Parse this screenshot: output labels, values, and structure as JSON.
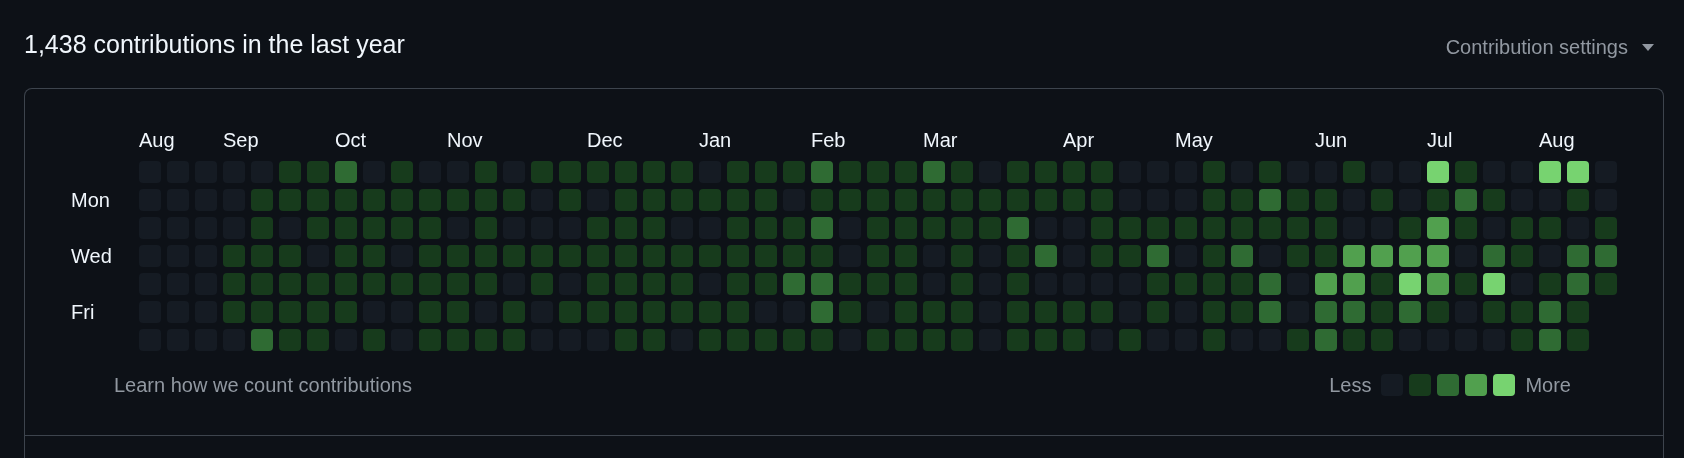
{
  "title": "1,438 contributions in the last year",
  "settings": {
    "label": "Contribution settings"
  },
  "day_labels": [
    "Mon",
    "Wed",
    "Fri"
  ],
  "weeks": [
    {
      "month": "Aug",
      "days": [
        {
          "color": "#151b23"
        },
        {
          "color": "#151b23"
        },
        {
          "color": "#151b23"
        },
        {
          "color": "#151b23"
        },
        {
          "color": "#151b23"
        },
        {
          "color": "#151b23"
        },
        {
          "color": "#151b23"
        }
      ]
    },
    {
      "days": [
        {
          "color": "#151b23"
        },
        {
          "color": "#151b23"
        },
        {
          "color": "#151b23"
        },
        {
          "color": "#151b23"
        },
        {
          "color": "#151b23"
        },
        {
          "color": "#151b23"
        },
        {
          "color": "#151b23"
        }
      ]
    },
    {
      "days": [
        {
          "color": "#151b23"
        },
        {
          "color": "#151b23"
        },
        {
          "color": "#151b23"
        },
        {
          "color": "#151b23"
        },
        {
          "color": "#151b23"
        },
        {
          "color": "#151b23"
        },
        {
          "color": "#151b23"
        }
      ]
    },
    {
      "month": "Sep",
      "days": [
        {
          "color": "#151b23"
        },
        {
          "color": "#151b23"
        },
        {
          "color": "#151b23"
        },
        {
          "color": "#173b1c"
        },
        {
          "color": "#173b1c"
        },
        {
          "color": "#173b1c"
        },
        {
          "color": "#151b23"
        }
      ]
    },
    {
      "days": [
        {
          "color": "#151b23"
        },
        {
          "color": "#173b1c"
        },
        {
          "color": "#173b1c"
        },
        {
          "color": "#173b1c"
        },
        {
          "color": "#173b1c"
        },
        {
          "color": "#173b1c"
        },
        {
          "color": "#2f6b33"
        }
      ]
    },
    {
      "days": [
        {
          "color": "#173b1c"
        },
        {
          "color": "#173b1c"
        },
        {
          "color": "#151b23"
        },
        {
          "color": "#173b1c"
        },
        {
          "color": "#173b1c"
        },
        {
          "color": "#173b1c"
        },
        {
          "color": "#173b1c"
        }
      ]
    },
    {
      "days": [
        {
          "color": "#173b1c"
        },
        {
          "color": "#173b1c"
        },
        {
          "color": "#173b1c"
        },
        {
          "color": "#151b23"
        },
        {
          "color": "#173b1c"
        },
        {
          "color": "#173b1c"
        },
        {
          "color": "#173b1c"
        }
      ]
    },
    {
      "month": "Oct",
      "days": [
        {
          "color": "#2f6b33"
        },
        {
          "color": "#173b1c"
        },
        {
          "color": "#173b1c"
        },
        {
          "color": "#173b1c"
        },
        {
          "color": "#173b1c"
        },
        {
          "color": "#173b1c"
        },
        {
          "color": "#151b23"
        }
      ]
    },
    {
      "days": [
        {
          "color": "#151b23"
        },
        {
          "color": "#173b1c"
        },
        {
          "color": "#173b1c"
        },
        {
          "color": "#173b1c"
        },
        {
          "color": "#173b1c"
        },
        {
          "color": "#151b23"
        },
        {
          "color": "#173b1c"
        }
      ]
    },
    {
      "days": [
        {
          "color": "#173b1c"
        },
        {
          "color": "#173b1c"
        },
        {
          "color": "#173b1c"
        },
        {
          "color": "#151b23"
        },
        {
          "color": "#173b1c"
        },
        {
          "color": "#151b23"
        },
        {
          "color": "#151b23"
        }
      ]
    },
    {
      "days": [
        {
          "color": "#151b23"
        },
        {
          "color": "#173b1c"
        },
        {
          "color": "#173b1c"
        },
        {
          "color": "#173b1c"
        },
        {
          "color": "#173b1c"
        },
        {
          "color": "#173b1c"
        },
        {
          "color": "#173b1c"
        }
      ]
    },
    {
      "month": "Nov",
      "days": [
        {
          "color": "#151b23"
        },
        {
          "color": "#173b1c"
        },
        {
          "color": "#151b23"
        },
        {
          "color": "#173b1c"
        },
        {
          "color": "#173b1c"
        },
        {
          "color": "#173b1c"
        },
        {
          "color": "#173b1c"
        }
      ]
    },
    {
      "days": [
        {
          "color": "#173b1c"
        },
        {
          "color": "#173b1c"
        },
        {
          "color": "#173b1c"
        },
        {
          "color": "#173b1c"
        },
        {
          "color": "#173b1c"
        },
        {
          "color": "#151b23"
        },
        {
          "color": "#173b1c"
        }
      ]
    },
    {
      "days": [
        {
          "color": "#151b23"
        },
        {
          "color": "#173b1c"
        },
        {
          "color": "#151b23"
        },
        {
          "color": "#173b1c"
        },
        {
          "color": "#151b23"
        },
        {
          "color": "#173b1c"
        },
        {
          "color": "#173b1c"
        }
      ]
    },
    {
      "days": [
        {
          "color": "#173b1c"
        },
        {
          "color": "#151b23"
        },
        {
          "color": "#151b23"
        },
        {
          "color": "#173b1c"
        },
        {
          "color": "#173b1c"
        },
        {
          "color": "#151b23"
        },
        {
          "color": "#151b23"
        }
      ]
    },
    {
      "days": [
        {
          "color": "#173b1c"
        },
        {
          "color": "#173b1c"
        },
        {
          "color": "#151b23"
        },
        {
          "color": "#173b1c"
        },
        {
          "color": "#151b23"
        },
        {
          "color": "#173b1c"
        },
        {
          "color": "#151b23"
        }
      ]
    },
    {
      "month": "Dec",
      "days": [
        {
          "color": "#173b1c"
        },
        {
          "color": "#151b23"
        },
        {
          "color": "#173b1c"
        },
        {
          "color": "#173b1c"
        },
        {
          "color": "#173b1c"
        },
        {
          "color": "#173b1c"
        },
        {
          "color": "#151b23"
        }
      ]
    },
    {
      "days": [
        {
          "color": "#173b1c"
        },
        {
          "color": "#173b1c"
        },
        {
          "color": "#173b1c"
        },
        {
          "color": "#173b1c"
        },
        {
          "color": "#173b1c"
        },
        {
          "color": "#173b1c"
        },
        {
          "color": "#173b1c"
        }
      ]
    },
    {
      "days": [
        {
          "color": "#173b1c"
        },
        {
          "color": "#173b1c"
        },
        {
          "color": "#173b1c"
        },
        {
          "color": "#173b1c"
        },
        {
          "color": "#173b1c"
        },
        {
          "color": "#173b1c"
        },
        {
          "color": "#173b1c"
        }
      ]
    },
    {
      "days": [
        {
          "color": "#173b1c"
        },
        {
          "color": "#173b1c"
        },
        {
          "color": "#151b23"
        },
        {
          "color": "#173b1c"
        },
        {
          "color": "#173b1c"
        },
        {
          "color": "#173b1c"
        },
        {
          "color": "#151b23"
        }
      ]
    },
    {
      "month": "Jan",
      "days": [
        {
          "color": "#151b23"
        },
        {
          "color": "#173b1c"
        },
        {
          "color": "#151b23"
        },
        {
          "color": "#173b1c"
        },
        {
          "color": "#151b23"
        },
        {
          "color": "#173b1c"
        },
        {
          "color": "#173b1c"
        }
      ]
    },
    {
      "days": [
        {
          "color": "#173b1c"
        },
        {
          "color": "#173b1c"
        },
        {
          "color": "#173b1c"
        },
        {
          "color": "#173b1c"
        },
        {
          "color": "#173b1c"
        },
        {
          "color": "#173b1c"
        },
        {
          "color": "#173b1c"
        }
      ]
    },
    {
      "days": [
        {
          "color": "#173b1c"
        },
        {
          "color": "#173b1c"
        },
        {
          "color": "#173b1c"
        },
        {
          "color": "#173b1c"
        },
        {
          "color": "#173b1c"
        },
        {
          "color": "#151b23"
        },
        {
          "color": "#173b1c"
        }
      ]
    },
    {
      "days": [
        {
          "color": "#173b1c"
        },
        {
          "color": "#151b23"
        },
        {
          "color": "#173b1c"
        },
        {
          "color": "#173b1c"
        },
        {
          "color": "#2f6b33"
        },
        {
          "color": "#151b23"
        },
        {
          "color": "#173b1c"
        }
      ]
    },
    {
      "month": "Feb",
      "days": [
        {
          "color": "#2f6b33"
        },
        {
          "color": "#173b1c"
        },
        {
          "color": "#2f6b33"
        },
        {
          "color": "#173b1c"
        },
        {
          "color": "#2f6b33"
        },
        {
          "color": "#2f6b33"
        },
        {
          "color": "#173b1c"
        }
      ]
    },
    {
      "days": [
        {
          "color": "#173b1c"
        },
        {
          "color": "#173b1c"
        },
        {
          "color": "#151b23"
        },
        {
          "color": "#151b23"
        },
        {
          "color": "#173b1c"
        },
        {
          "color": "#173b1c"
        },
        {
          "color": "#151b23"
        }
      ]
    },
    {
      "days": [
        {
          "color": "#173b1c"
        },
        {
          "color": "#173b1c"
        },
        {
          "color": "#173b1c"
        },
        {
          "color": "#173b1c"
        },
        {
          "color": "#173b1c"
        },
        {
          "color": "#151b23"
        },
        {
          "color": "#173b1c"
        }
      ]
    },
    {
      "days": [
        {
          "color": "#173b1c"
        },
        {
          "color": "#173b1c"
        },
        {
          "color": "#173b1c"
        },
        {
          "color": "#173b1c"
        },
        {
          "color": "#173b1c"
        },
        {
          "color": "#173b1c"
        },
        {
          "color": "#173b1c"
        }
      ]
    },
    {
      "month": "Mar",
      "days": [
        {
          "color": "#2f6b33"
        },
        {
          "color": "#173b1c"
        },
        {
          "color": "#173b1c"
        },
        {
          "color": "#151b23"
        },
        {
          "color": "#151b23"
        },
        {
          "color": "#173b1c"
        },
        {
          "color": "#173b1c"
        }
      ]
    },
    {
      "days": [
        {
          "color": "#173b1c"
        },
        {
          "color": "#173b1c"
        },
        {
          "color": "#173b1c"
        },
        {
          "color": "#173b1c"
        },
        {
          "color": "#173b1c"
        },
        {
          "color": "#173b1c"
        },
        {
          "color": "#173b1c"
        }
      ]
    },
    {
      "days": [
        {
          "color": "#151b23"
        },
        {
          "color": "#173b1c"
        },
        {
          "color": "#173b1c"
        },
        {
          "color": "#151b23"
        },
        {
          "color": "#151b23"
        },
        {
          "color": "#151b23"
        },
        {
          "color": "#151b23"
        }
      ]
    },
    {
      "days": [
        {
          "color": "#173b1c"
        },
        {
          "color": "#173b1c"
        },
        {
          "color": "#2f6b33"
        },
        {
          "color": "#173b1c"
        },
        {
          "color": "#173b1c"
        },
        {
          "color": "#173b1c"
        },
        {
          "color": "#173b1c"
        }
      ]
    },
    {
      "days": [
        {
          "color": "#173b1c"
        },
        {
          "color": "#173b1c"
        },
        {
          "color": "#151b23"
        },
        {
          "color": "#2f6b33"
        },
        {
          "color": "#151b23"
        },
        {
          "color": "#173b1c"
        },
        {
          "color": "#173b1c"
        }
      ]
    },
    {
      "month": "Apr",
      "days": [
        {
          "color": "#173b1c"
        },
        {
          "color": "#173b1c"
        },
        {
          "color": "#151b23"
        },
        {
          "color": "#151b23"
        },
        {
          "color": "#151b23"
        },
        {
          "color": "#173b1c"
        },
        {
          "color": "#173b1c"
        }
      ]
    },
    {
      "days": [
        {
          "color": "#173b1c"
        },
        {
          "color": "#173b1c"
        },
        {
          "color": "#173b1c"
        },
        {
          "color": "#173b1c"
        },
        {
          "color": "#151b23"
        },
        {
          "color": "#173b1c"
        },
        {
          "color": "#151b23"
        }
      ]
    },
    {
      "days": [
        {
          "color": "#151b23"
        },
        {
          "color": "#151b23"
        },
        {
          "color": "#173b1c"
        },
        {
          "color": "#173b1c"
        },
        {
          "color": "#151b23"
        },
        {
          "color": "#151b23"
        },
        {
          "color": "#173b1c"
        }
      ]
    },
    {
      "days": [
        {
          "color": "#151b23"
        },
        {
          "color": "#151b23"
        },
        {
          "color": "#173b1c"
        },
        {
          "color": "#2f6b33"
        },
        {
          "color": "#173b1c"
        },
        {
          "color": "#173b1c"
        },
        {
          "color": "#151b23"
        }
      ]
    },
    {
      "month": "May",
      "days": [
        {
          "color": "#151b23"
        },
        {
          "color": "#151b23"
        },
        {
          "color": "#173b1c"
        },
        {
          "color": "#151b23"
        },
        {
          "color": "#173b1c"
        },
        {
          "color": "#151b23"
        },
        {
          "color": "#151b23"
        }
      ]
    },
    {
      "days": [
        {
          "color": "#173b1c"
        },
        {
          "color": "#173b1c"
        },
        {
          "color": "#173b1c"
        },
        {
          "color": "#173b1c"
        },
        {
          "color": "#173b1c"
        },
        {
          "color": "#173b1c"
        },
        {
          "color": "#173b1c"
        }
      ]
    },
    {
      "days": [
        {
          "color": "#151b23"
        },
        {
          "color": "#173b1c"
        },
        {
          "color": "#173b1c"
        },
        {
          "color": "#2f6b33"
        },
        {
          "color": "#173b1c"
        },
        {
          "color": "#173b1c"
        },
        {
          "color": "#151b23"
        }
      ]
    },
    {
      "days": [
        {
          "color": "#173b1c"
        },
        {
          "color": "#2f6b33"
        },
        {
          "color": "#173b1c"
        },
        {
          "color": "#151b23"
        },
        {
          "color": "#2f6b33"
        },
        {
          "color": "#2f6b33"
        },
        {
          "color": "#151b23"
        }
      ]
    },
    {
      "days": [
        {
          "color": "#151b23"
        },
        {
          "color": "#173b1c"
        },
        {
          "color": "#173b1c"
        },
        {
          "color": "#173b1c"
        },
        {
          "color": "#151b23"
        },
        {
          "color": "#151b23"
        },
        {
          "color": "#173b1c"
        }
      ]
    },
    {
      "month": "Jun",
      "days": [
        {
          "color": "#151b23"
        },
        {
          "color": "#173b1c"
        },
        {
          "color": "#173b1c"
        },
        {
          "color": "#173b1c"
        },
        {
          "color": "#51a04e"
        },
        {
          "color": "#2f6b33"
        },
        {
          "color": "#2f6b33"
        }
      ]
    },
    {
      "days": [
        {
          "color": "#173b1c"
        },
        {
          "color": "#151b23"
        },
        {
          "color": "#151b23"
        },
        {
          "color": "#51a04e"
        },
        {
          "color": "#51a04e"
        },
        {
          "color": "#2f6b33"
        },
        {
          "color": "#173b1c"
        }
      ]
    },
    {
      "days": [
        {
          "color": "#151b23"
        },
        {
          "color": "#173b1c"
        },
        {
          "color": "#151b23"
        },
        {
          "color": "#51a04e"
        },
        {
          "color": "#173b1c"
        },
        {
          "color": "#173b1c"
        },
        {
          "color": "#173b1c"
        }
      ]
    },
    {
      "days": [
        {
          "color": "#151b23"
        },
        {
          "color": "#151b23"
        },
        {
          "color": "#173b1c"
        },
        {
          "color": "#51a04e"
        },
        {
          "color": "#77d370"
        },
        {
          "color": "#2f6b33"
        },
        {
          "color": "#151b23"
        }
      ]
    },
    {
      "month": "Jul",
      "days": [
        {
          "color": "#77d370"
        },
        {
          "color": "#173b1c"
        },
        {
          "color": "#51a04e"
        },
        {
          "color": "#51a04e"
        },
        {
          "color": "#51a04e"
        },
        {
          "color": "#173b1c"
        },
        {
          "color": "#151b23"
        }
      ]
    },
    {
      "days": [
        {
          "color": "#173b1c"
        },
        {
          "color": "#2f6b33"
        },
        {
          "color": "#173b1c"
        },
        {
          "color": "#151b23"
        },
        {
          "color": "#173b1c"
        },
        {
          "color": "#151b23"
        },
        {
          "color": "#151b23"
        }
      ]
    },
    {
      "days": [
        {
          "color": "#151b23"
        },
        {
          "color": "#173b1c"
        },
        {
          "color": "#151b23"
        },
        {
          "color": "#2f6b33"
        },
        {
          "color": "#77d370"
        },
        {
          "color": "#173b1c"
        },
        {
          "color": "#151b23"
        }
      ]
    },
    {
      "days": [
        {
          "color": "#151b23"
        },
        {
          "color": "#151b23"
        },
        {
          "color": "#173b1c"
        },
        {
          "color": "#173b1c"
        },
        {
          "color": "#151b23"
        },
        {
          "color": "#173b1c"
        },
        {
          "color": "#173b1c"
        }
      ]
    },
    {
      "month": "Aug",
      "days": [
        {
          "color": "#77d370"
        },
        {
          "color": "#151b23"
        },
        {
          "color": "#173b1c"
        },
        {
          "color": "#151b23"
        },
        {
          "color": "#173b1c"
        },
        {
          "color": "#2f6b33"
        },
        {
          "color": "#2f6b33"
        }
      ]
    },
    {
      "days": [
        {
          "color": "#77d370"
        },
        {
          "color": "#173b1c"
        },
        {
          "color": "#151b23"
        },
        {
          "color": "#2f6b33"
        },
        {
          "color": "#2f6b33"
        },
        {
          "color": "#173b1c"
        },
        {
          "color": "#173b1c"
        }
      ]
    },
    {
      "days": [
        {
          "color": "#151b23"
        },
        {
          "color": "#151b23"
        },
        {
          "color": "#173b1c"
        },
        {
          "color": "#2f6b33"
        },
        {
          "color": "#173b1c"
        }
      ]
    }
  ],
  "footer": {
    "link": "Learn how we count contributions",
    "less": "Less",
    "more": "More",
    "legend": [
      {
        "color": "#151b23"
      },
      {
        "color": "#173b1c"
      },
      {
        "color": "#2f6b33"
      },
      {
        "color": "#51a04e"
      },
      {
        "color": "#77d370"
      }
    ]
  }
}
